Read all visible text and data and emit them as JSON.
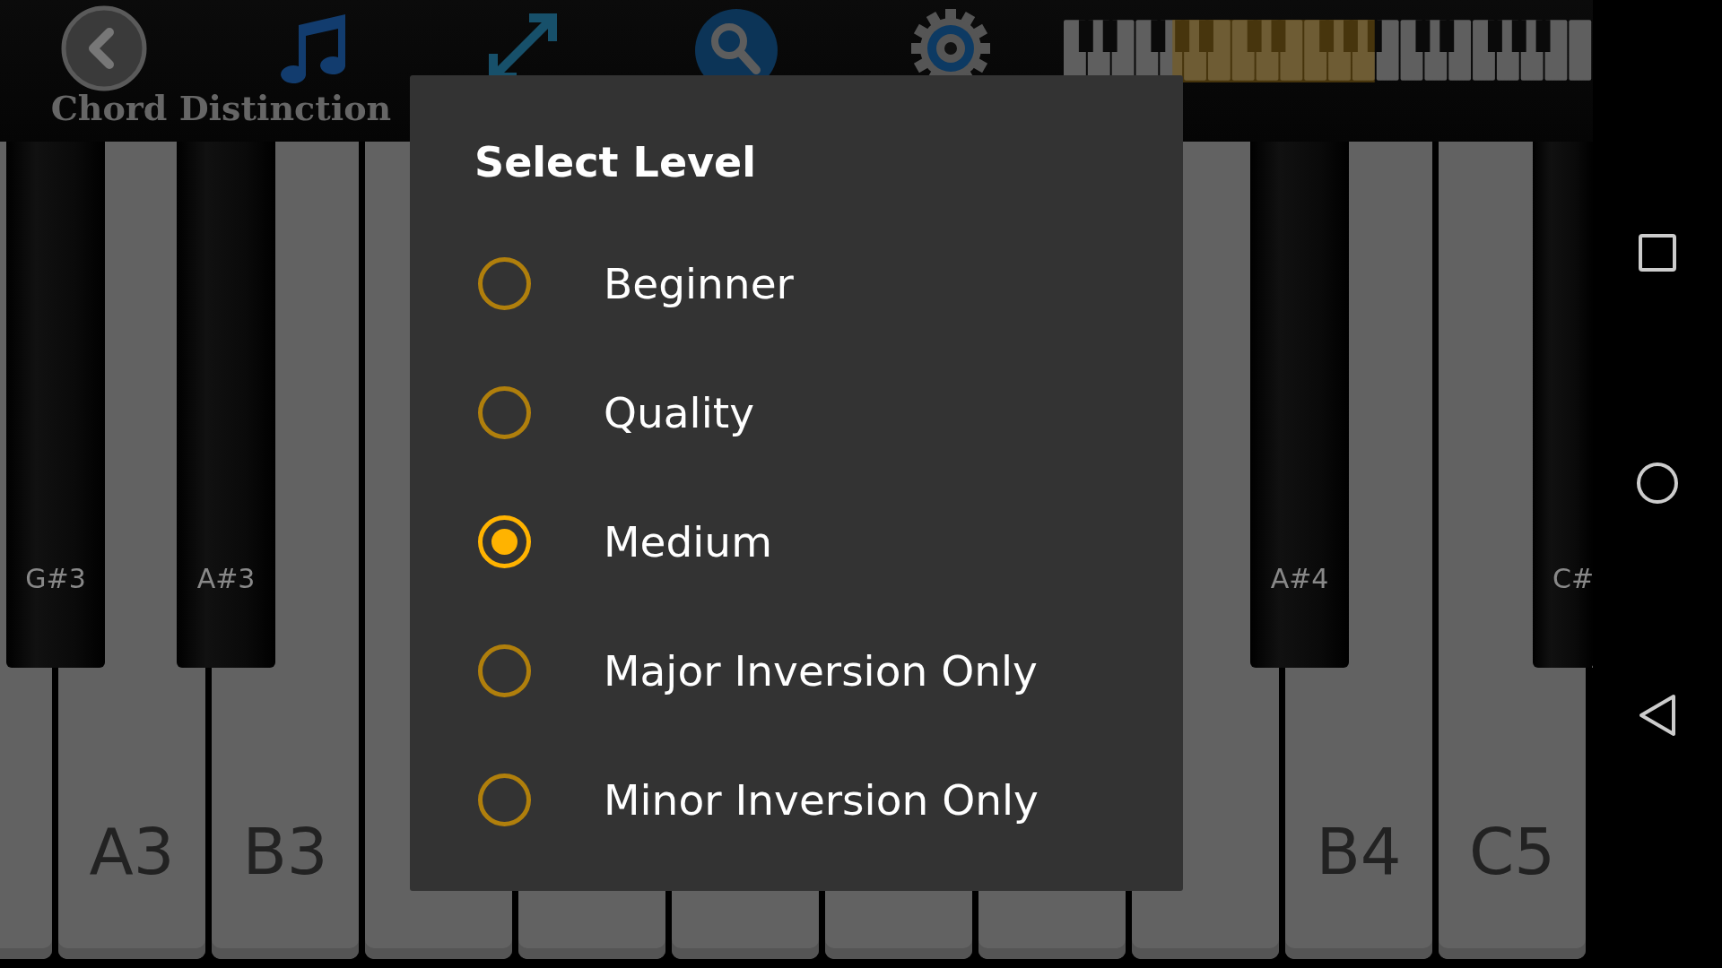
{
  "app": {
    "title": "Chord Distinction"
  },
  "keyboard": {
    "white_keys": [
      {
        "label": "A3"
      },
      {
        "label": "B3"
      },
      {
        "label": "B4"
      },
      {
        "label": "C5"
      }
    ],
    "black_keys": [
      {
        "label": "G#3"
      },
      {
        "label": "A#3"
      },
      {
        "label": "A#4"
      },
      {
        "label": "C#"
      }
    ]
  },
  "dialog": {
    "title": "Select Level",
    "options": [
      {
        "label": "Beginner",
        "selected": false
      },
      {
        "label": "Quality",
        "selected": false
      },
      {
        "label": "Medium",
        "selected": true
      },
      {
        "label": "Major Inversion Only",
        "selected": false
      },
      {
        "label": "Minor Inversion Only",
        "selected": false
      }
    ]
  }
}
